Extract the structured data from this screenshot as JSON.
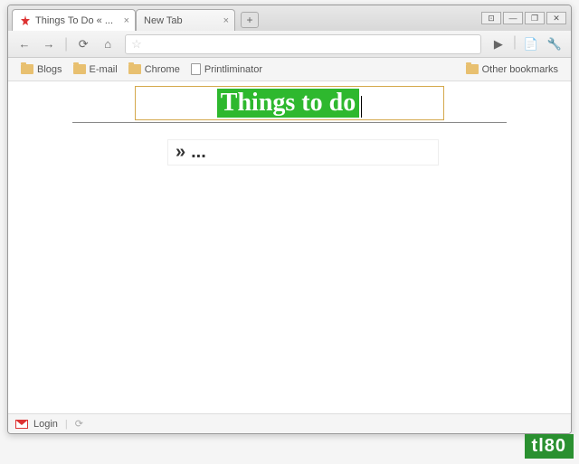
{
  "tabs": [
    {
      "label": "Things To Do « ...",
      "active": true
    },
    {
      "label": "New Tab",
      "active": false
    }
  ],
  "toolbar": {
    "back": "←",
    "forward": "→",
    "reload": "⟳",
    "home": "⌂",
    "play": "▶",
    "page_menu": "▾",
    "wrench": "🔧"
  },
  "bookmarks": {
    "items": [
      {
        "label": "Blogs",
        "type": "folder"
      },
      {
        "label": "E-mail",
        "type": "folder"
      },
      {
        "label": "Chrome",
        "type": "folder"
      },
      {
        "label": "Printliminator",
        "type": "page"
      }
    ],
    "other": "Other bookmarks"
  },
  "page": {
    "title": "Things to do",
    "bullet": "»",
    "placeholder": "..."
  },
  "status": {
    "login": "Login"
  },
  "window": {
    "minimize": "—",
    "maximize": "❐",
    "close": "✕",
    "extra": "⊡"
  },
  "watermark": "tl80"
}
